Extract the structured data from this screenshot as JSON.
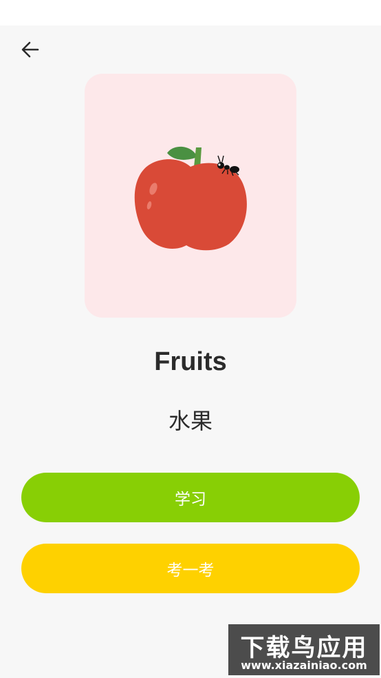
{
  "header": {
    "back_icon": "arrow-left-icon"
  },
  "card": {
    "image_icon": "apple-with-ant-illustration",
    "background_color": "#fde8ea"
  },
  "content": {
    "title": "Fruits",
    "subtitle": "水果"
  },
  "buttons": {
    "learn_label": "学习",
    "learn_color": "#88cf05",
    "quiz_label": "考一考",
    "quiz_color": "#fed100"
  },
  "watermark": {
    "title": "下载鸟应用",
    "url": "www.xiazainiao.com"
  }
}
